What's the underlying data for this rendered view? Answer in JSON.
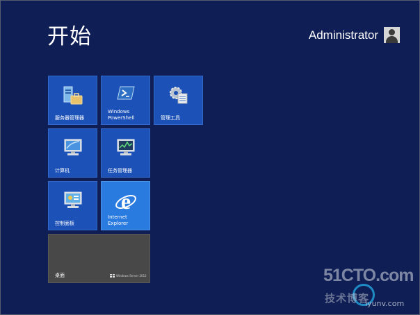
{
  "start": {
    "title": "开始"
  },
  "user": {
    "name": "Administrator"
  },
  "tiles": [
    {
      "label": "服务器管理器",
      "icon": "server-manager-icon"
    },
    {
      "label": "Windows\nPowerShell",
      "icon": "powershell-icon"
    },
    {
      "label": "管理工具",
      "icon": "admin-tools-icon"
    },
    {
      "label": "计算机",
      "icon": "computer-icon"
    },
    {
      "label": "任务管理器",
      "icon": "task-manager-icon"
    },
    {
      "label": "控制面板",
      "icon": "control-panel-icon"
    },
    {
      "label": "Internet\nExplorer",
      "icon": "internet-explorer-icon"
    },
    {
      "label": "桌面",
      "icon": "desktop-icon",
      "logo_text": "Windows Server 2012"
    }
  ],
  "watermark": {
    "line1": "51CTO.com",
    "line2": "技术博客",
    "line3": "iyunv.com"
  },
  "colors": {
    "background": "#0f1f55",
    "tile": "#1c51b8",
    "ie_tile": "#2a7bdf",
    "desktop_tile": "#484848"
  }
}
